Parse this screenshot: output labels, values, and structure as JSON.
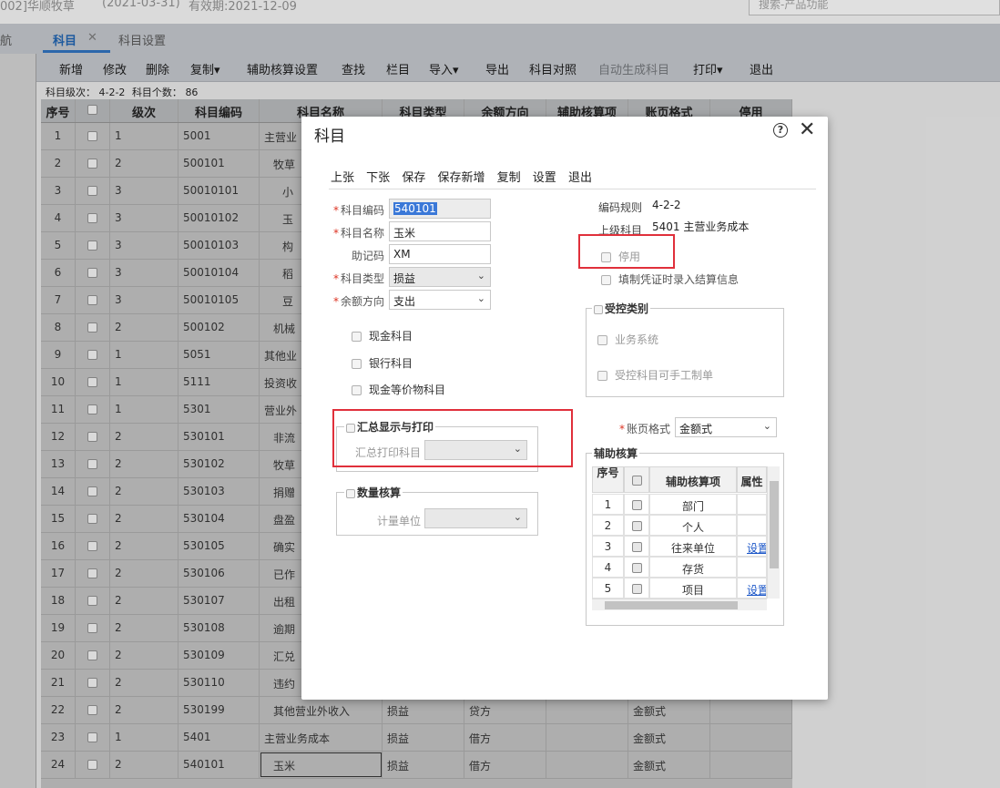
{
  "window": {
    "title": "002]华顺牧草",
    "date": "(2021-03-31)",
    "validity": "有效期:2021-12-09",
    "search_placeholder": "搜索-产品功能"
  },
  "tabs": {
    "nav_fragment": "航",
    "active": "科目",
    "close": "✕",
    "settings": "科目设置"
  },
  "toolbar": {
    "add": "新增",
    "edit": "修改",
    "delete": "删除",
    "copy": "复制",
    "aux_setting": "辅助核算设置",
    "find": "查找",
    "columns": "栏目",
    "import": "导入",
    "export": "导出",
    "compare": "科目对照",
    "auto_generate": "自动生成科目",
    "print": "打印",
    "exit": "退出",
    "dropdown_arrow": "▾"
  },
  "summary": {
    "levels_label": "科目级次：",
    "levels": "4-2-2",
    "count_label": "科目个数：",
    "count": "86"
  },
  "grid": {
    "headers": [
      "序号",
      "",
      "级次",
      "科目编码",
      "科目名称",
      "科目类型",
      "余额方向",
      "辅助核算项",
      "账页格式",
      "停用"
    ],
    "rows": [
      {
        "no": "1",
        "level": "1",
        "code": "5001",
        "name": "主营业",
        "type": "",
        "dir": "",
        "aux": "",
        "fmt": ""
      },
      {
        "no": "2",
        "level": "2",
        "code": "500101",
        "name": "牧草",
        "type": "",
        "dir": "",
        "aux": "",
        "fmt": ""
      },
      {
        "no": "3",
        "level": "3",
        "code": "50010101",
        "name": "小",
        "type": "",
        "dir": "",
        "aux": "",
        "fmt": ""
      },
      {
        "no": "4",
        "level": "3",
        "code": "50010102",
        "name": "玉",
        "type": "",
        "dir": "",
        "aux": "",
        "fmt": ""
      },
      {
        "no": "5",
        "level": "3",
        "code": "50010103",
        "name": "构",
        "type": "",
        "dir": "",
        "aux": "",
        "fmt": ""
      },
      {
        "no": "6",
        "level": "3",
        "code": "50010104",
        "name": "稻",
        "type": "",
        "dir": "",
        "aux": "",
        "fmt": ""
      },
      {
        "no": "7",
        "level": "3",
        "code": "50010105",
        "name": "豆",
        "type": "",
        "dir": "",
        "aux": "",
        "fmt": ""
      },
      {
        "no": "8",
        "level": "2",
        "code": "500102",
        "name": "机械",
        "type": "",
        "dir": "",
        "aux": "",
        "fmt": ""
      },
      {
        "no": "9",
        "level": "1",
        "code": "5051",
        "name": "其他业",
        "type": "",
        "dir": "",
        "aux": "",
        "fmt": ""
      },
      {
        "no": "10",
        "level": "1",
        "code": "5111",
        "name": "投资收",
        "type": "",
        "dir": "",
        "aux": "",
        "fmt": ""
      },
      {
        "no": "11",
        "level": "1",
        "code": "5301",
        "name": "营业外",
        "type": "",
        "dir": "",
        "aux": "",
        "fmt": ""
      },
      {
        "no": "12",
        "level": "2",
        "code": "530101",
        "name": "非流",
        "type": "",
        "dir": "",
        "aux": "",
        "fmt": ""
      },
      {
        "no": "13",
        "level": "2",
        "code": "530102",
        "name": "牧草",
        "type": "",
        "dir": "",
        "aux": "",
        "fmt": ""
      },
      {
        "no": "14",
        "level": "2",
        "code": "530103",
        "name": "捐赠",
        "type": "",
        "dir": "",
        "aux": "",
        "fmt": ""
      },
      {
        "no": "15",
        "level": "2",
        "code": "530104",
        "name": "盘盈",
        "type": "",
        "dir": "",
        "aux": "",
        "fmt": ""
      },
      {
        "no": "16",
        "level": "2",
        "code": "530105",
        "name": "确实",
        "type": "",
        "dir": "",
        "aux": "",
        "fmt": ""
      },
      {
        "no": "17",
        "level": "2",
        "code": "530106",
        "name": "已作",
        "type": "",
        "dir": "",
        "aux": "",
        "fmt": ""
      },
      {
        "no": "18",
        "level": "2",
        "code": "530107",
        "name": "出租",
        "type": "",
        "dir": "",
        "aux": "",
        "fmt": ""
      },
      {
        "no": "19",
        "level": "2",
        "code": "530108",
        "name": "逾期",
        "type": "",
        "dir": "",
        "aux": "",
        "fmt": ""
      },
      {
        "no": "20",
        "level": "2",
        "code": "530109",
        "name": "汇兑",
        "type": "",
        "dir": "",
        "aux": "",
        "fmt": ""
      },
      {
        "no": "21",
        "level": "2",
        "code": "530110",
        "name": "违约",
        "type": "",
        "dir": "",
        "aux": "",
        "fmt": ""
      },
      {
        "no": "22",
        "level": "2",
        "code": "530199",
        "name": "其他营业外收入",
        "type": "损益",
        "dir": "贷方",
        "aux": "",
        "fmt": "金额式"
      },
      {
        "no": "23",
        "level": "1",
        "code": "5401",
        "name": "主营业务成本",
        "type": "损益",
        "dir": "借方",
        "aux": "",
        "fmt": "金额式"
      },
      {
        "no": "24",
        "level": "2",
        "code": "540101",
        "name": "玉米",
        "type": "损益",
        "dir": "借方",
        "aux": "",
        "fmt": "金额式"
      }
    ]
  },
  "dialog": {
    "title": "科目",
    "help": "?",
    "close": "✕",
    "actions": {
      "prev": "上张",
      "next": "下张",
      "save": "保存",
      "save_new": "保存新增",
      "copy": "复制",
      "settings": "设置",
      "exit": "退出"
    },
    "form": {
      "required_mark": "*",
      "code_label": "科目编码",
      "code_value": "540101",
      "name_label": "科目名称",
      "name_value": "玉米",
      "mnemonic_label": "助记码",
      "mnemonic_value": "XM",
      "type_label": "科目类型",
      "type_value": "损益",
      "direction_label": "余额方向",
      "direction_value": "支出",
      "select_arrow": "⌄",
      "cash": "现金科目",
      "bank": "银行科目",
      "cash_equiv": "现金等价物科目",
      "summary_group": "汇总显示与打印",
      "summary_print_label": "汇总打印科目",
      "qty_group": "数量核算",
      "unit_label": "计量单位"
    },
    "right": {
      "rule_label": "编码规则",
      "rule_value": "4-2-2",
      "parent_label": "上级科目",
      "parent_value": "5401 主营业务成本",
      "disabled": "停用",
      "settle_info": "填制凭证时录入结算信息",
      "controlled_group": "受控类别",
      "business_system": "业务系统",
      "manual_voucher": "受控科目可手工制单",
      "ledger_label": "账页格式",
      "ledger_value": "金额式",
      "aux_group": "辅助核算",
      "aux_headers": [
        "序号",
        "",
        "辅助核算项",
        "属性"
      ],
      "aux_rows": [
        {
          "no": "1",
          "item": "部门",
          "attr": ""
        },
        {
          "no": "2",
          "item": "个人",
          "attr": ""
        },
        {
          "no": "3",
          "item": "往来单位",
          "attr": "设置"
        },
        {
          "no": "4",
          "item": "存货",
          "attr": ""
        },
        {
          "no": "5",
          "item": "项目",
          "attr": "设置"
        }
      ]
    }
  }
}
